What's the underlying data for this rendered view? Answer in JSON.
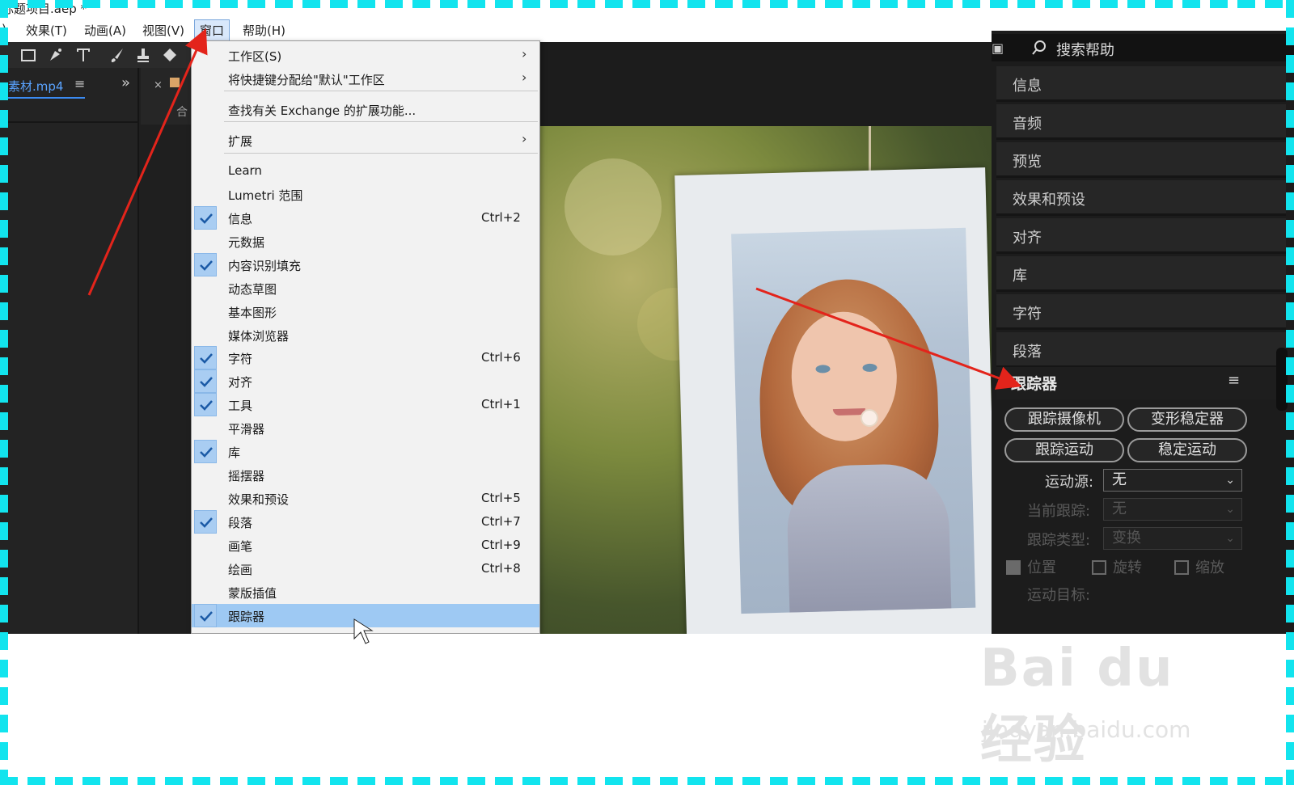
{
  "window": {
    "title": "标题项目.aep *"
  },
  "menubar": {
    "items": [
      {
        "label": ")"
      },
      {
        "label": "效果(T)"
      },
      {
        "label": "动画(A)"
      },
      {
        "label": "视图(V)"
      },
      {
        "label": "窗口"
      },
      {
        "label": "帮助(H)"
      }
    ]
  },
  "project_panel": {
    "tab_label": "素材.mp4",
    "menu_glyph": "≡",
    "expand_glyph": "»"
  },
  "composition": {
    "close_glyph": "×",
    "label": "合"
  },
  "window_menu": {
    "items": [
      {
        "label": "工作区(S)",
        "submenu": true
      },
      {
        "label": "将快捷键分配给\"默认\"工作区",
        "submenu": true
      },
      {
        "label": "查找有关 Exchange 的扩展功能..."
      },
      {
        "label": "扩展",
        "submenu": true
      },
      {
        "label": "Learn"
      },
      {
        "label": "Lumetri 范围"
      },
      {
        "label": "信息",
        "checked": true,
        "shortcut": "Ctrl+2"
      },
      {
        "label": "元数据"
      },
      {
        "label": "内容识别填充",
        "checked": true
      },
      {
        "label": "动态草图"
      },
      {
        "label": "基本图形"
      },
      {
        "label": "媒体浏览器"
      },
      {
        "label": "字符",
        "checked": true,
        "shortcut": "Ctrl+6"
      },
      {
        "label": "对齐",
        "checked": true
      },
      {
        "label": "工具",
        "checked": true,
        "shortcut": "Ctrl+1"
      },
      {
        "label": "平滑器"
      },
      {
        "label": "库",
        "checked": true
      },
      {
        "label": "摇摆器"
      },
      {
        "label": "效果和预设",
        "shortcut": "Ctrl+5"
      },
      {
        "label": "段落",
        "checked": true,
        "shortcut": "Ctrl+7"
      },
      {
        "label": "画笔",
        "shortcut": "Ctrl+9"
      },
      {
        "label": "绘画",
        "shortcut": "Ctrl+8"
      },
      {
        "label": "蒙版插值"
      },
      {
        "label": "跟踪器",
        "checked": true,
        "highlighted": true
      }
    ],
    "arrow_glyph": "›"
  },
  "right_panel": {
    "search_placeholder": "搜索帮助",
    "panels": [
      "信息",
      "音频",
      "预览",
      "效果和预设",
      "对齐",
      "库",
      "字符",
      "段落"
    ],
    "tracker": {
      "title": "跟踪器",
      "menu_glyph": "≡",
      "buttons": {
        "track_camera": "跟踪摄像机",
        "warp_stabilizer": "变形稳定器",
        "track_motion": "跟踪运动",
        "stabilize_motion": "稳定运动"
      },
      "motion_source_label": "运动源:",
      "motion_source_value": "无",
      "current_track_label": "当前跟踪:",
      "current_track_value": "无",
      "track_type_label": "跟踪类型:",
      "track_type_value": "变换",
      "position_label": "位置",
      "rotation_label": "旋转",
      "scale_label": "缩放",
      "motion_target_label": "运动目标:"
    }
  },
  "watermark": {
    "logo": "Bai du 经验",
    "url": "jingyan.baidu.com"
  },
  "colors": {
    "accent_frame": "#12e4ee",
    "menu_highlight": "#9ec9f3",
    "arrow": "#e3241b"
  }
}
